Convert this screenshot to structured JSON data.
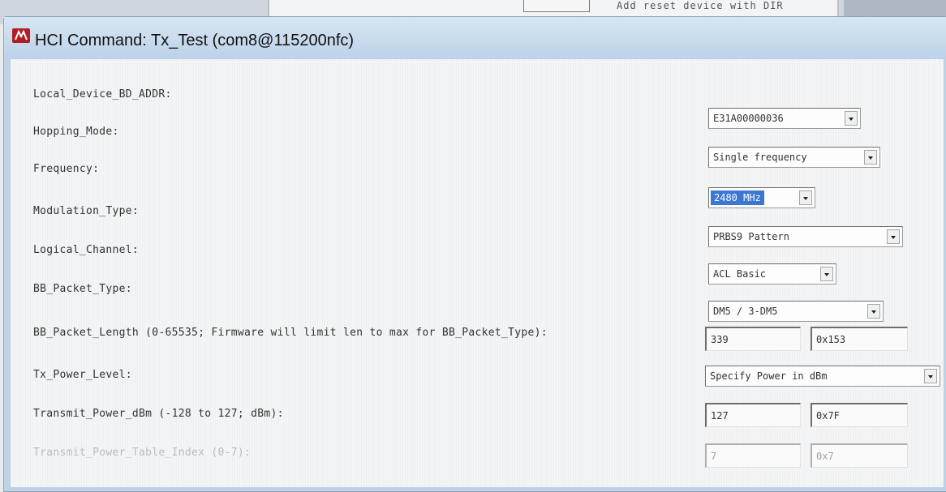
{
  "background_window": {
    "fragment_text": "Add reset device with DIR"
  },
  "dialog": {
    "title": "HCI Command: Tx_Test (com8@115200nfc)",
    "icon": "bluetooth-app-icon"
  },
  "params": {
    "bd_addr": {
      "label": "Local_Device_BD_ADDR:",
      "value": "E31A00000036"
    },
    "hopping": {
      "label": "Hopping_Mode:",
      "value": "Single frequency"
    },
    "frequency": {
      "label": "Frequency:",
      "value": "2480 MHz"
    },
    "modulation": {
      "label": "Modulation_Type:",
      "value": "PRBS9 Pattern"
    },
    "logical_channel": {
      "label": "Logical_Channel:",
      "value": "ACL Basic"
    },
    "packet_type": {
      "label": "BB_Packet_Type:",
      "value": "DM5 / 3-DM5"
    },
    "packet_length": {
      "label": "BB_Packet_Length (0-65535; Firmware will limit len to max for BB_Packet_Type):",
      "dec": "339",
      "hex": "0x153"
    },
    "power_level": {
      "label": "Tx_Power_Level:",
      "value": "Specify Power in dBm"
    },
    "transmit_power": {
      "label": "Transmit_Power_dBm (-128 to 127; dBm):",
      "dec": "127",
      "hex": "0x7F"
    },
    "power_table_index": {
      "label": "Transmit_Power_Table_Index (0-7):",
      "dec": "7",
      "hex": "0x7"
    }
  }
}
